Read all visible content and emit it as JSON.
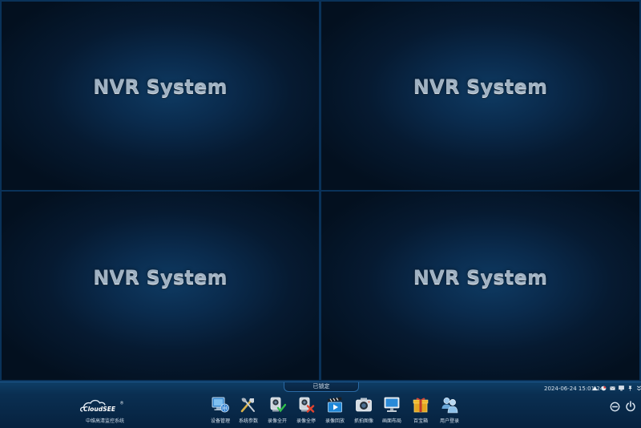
{
  "video_grid": {
    "cells": [
      {
        "brand": "NVR System"
      },
      {
        "brand": "NVR System"
      },
      {
        "brand": "NVR System"
      },
      {
        "brand": "NVR System"
      }
    ]
  },
  "taskbar": {
    "lock_status": "已锁定",
    "clock": "2024-06-24 15:01:24",
    "logo_text": "CloudSEE",
    "logo_mark": "®",
    "logo_caption": "中维高清监控系统",
    "toolbar": [
      {
        "label": "设备管理",
        "icon": "device-management-icon"
      },
      {
        "label": "系统参数",
        "icon": "system-settings-icon"
      },
      {
        "label": "录像全开",
        "icon": "record-all-on-icon"
      },
      {
        "label": "录像全停",
        "icon": "record-all-stop-icon"
      },
      {
        "label": "录像回放",
        "icon": "playback-icon"
      },
      {
        "label": "抓拍图像",
        "icon": "snapshot-icon"
      },
      {
        "label": "画面布局",
        "icon": "screen-layout-icon"
      },
      {
        "label": "百宝箱",
        "icon": "toolbox-icon"
      },
      {
        "label": "用户登录",
        "icon": "user-login-icon"
      }
    ],
    "tray": [
      "alarm-icon",
      "record-status-icon",
      "mail-icon",
      "network-icon",
      "pin-icon",
      "expand-icon"
    ]
  },
  "colors": {
    "background": "#020b18",
    "grid_line": "#0a3259",
    "taskbar": "#0a2f52",
    "brand_text": "#9fb1c2"
  }
}
